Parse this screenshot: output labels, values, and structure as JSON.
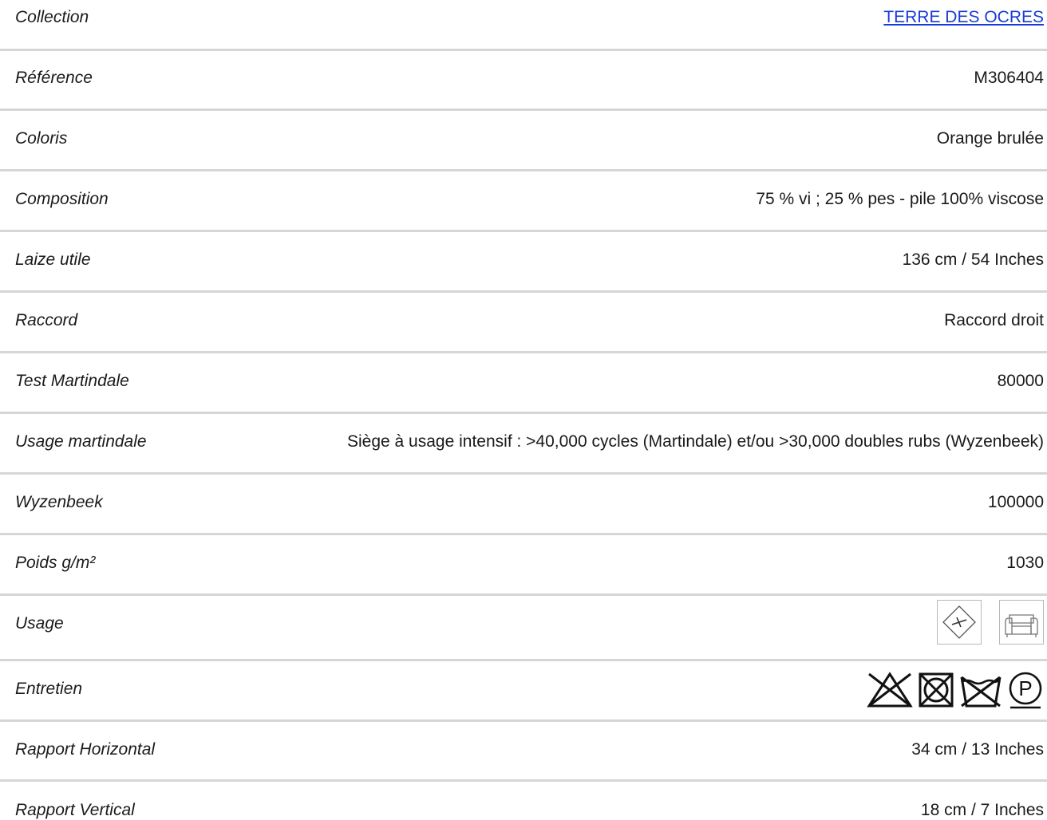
{
  "rows": [
    {
      "label": "Collection",
      "value": "TERRE DES OCRES"
    },
    {
      "label": "Référence",
      "value": "M306404"
    },
    {
      "label": "Coloris",
      "value": "Orange brulée"
    },
    {
      "label": "Composition",
      "value": "75 % vi ; 25 % pes - pile 100% viscose"
    },
    {
      "label": "Laize utile",
      "value": "136 cm / 54 Inches"
    },
    {
      "label": "Raccord",
      "value": "Raccord droit"
    },
    {
      "label": "Test Martindale",
      "value": "80000"
    },
    {
      "label": "Usage martindale",
      "value": "Siège à usage intensif : >40,000 cycles (Martindale) et/ou >30,000 doubles rubs (Wyzenbeek)"
    },
    {
      "label": "Wyzenbeek",
      "value": "100000"
    },
    {
      "label": "Poids g/m²",
      "value": "1030"
    },
    {
      "label": "Usage",
      "icons": [
        "upholstery-diamond-icon",
        "armchair-icon"
      ]
    },
    {
      "label": "Entretien",
      "icons": [
        "do-not-bleach-icon",
        "do-not-tumble-dry-icon",
        "do-not-wash-icon",
        "dry-clean-p-icon"
      ],
      "dry_clean_letter": "P"
    },
    {
      "label": "Rapport Horizontal",
      "value": "34 cm / 13 Inches"
    },
    {
      "label": "Rapport Vertical",
      "value": "18 cm / 7 Inches"
    }
  ],
  "colors": {
    "link": "#1a3bd6",
    "divider": "#d6d6d6",
    "text": "#1a1a1a"
  }
}
